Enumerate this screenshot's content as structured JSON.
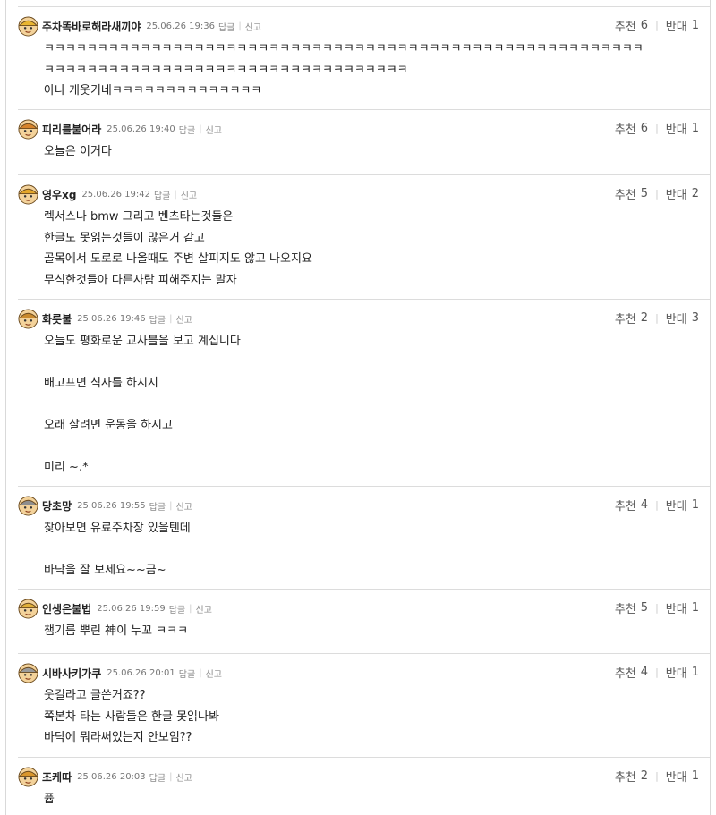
{
  "labels": {
    "reply": "답글",
    "report": "신고",
    "up": "추천",
    "down": "반대"
  },
  "comments": [
    {
      "nick": "주차똑바로해라새끼야",
      "date": "25.06.26 19:36",
      "up": "6",
      "down": "1",
      "lines": [
        "ㅋㅋㅋㅋㅋㅋㅋㅋㅋㅋㅋㅋㅋㅋㅋㅋㅋㅋㅋㅋㅋㅋㅋㅋㅋㅋㅋㅋㅋㅋㅋㅋㅋㅋㅋㅋㅋㅋㅋㅋㅋㅋㅋㅋㅋㅋㅋㅋㅋㅋㅋㅋㅋㅋㅋㅋ",
        "ㅋㅋㅋㅋㅋㅋㅋㅋㅋㅋㅋㅋㅋㅋㅋㅋㅋㅋㅋㅋㅋㅋㅋㅋㅋㅋㅋㅋㅋㅋㅋㅋㅋㅋ",
        "아나 개웃기네ㅋㅋㅋㅋㅋㅋㅋㅋㅋㅋㅋㅋㅋㅋ"
      ],
      "avatar_color": "#e9b530"
    },
    {
      "nick": "피리를불어라",
      "date": "25.06.26 19:40",
      "up": "6",
      "down": "1",
      "lines": [
        "오늘은 이거다"
      ],
      "avatar_color": "#d7842b"
    },
    {
      "nick": "영우xg",
      "date": "25.06.26 19:42",
      "up": "5",
      "down": "2",
      "lines": [
        "렉서스나 bmw 그리고 벤츠타는것들은",
        "한글도 못읽는것들이 많은거 같고",
        "골목에서 도로로 나올때도 주변 살피지도 않고 나오지요",
        "무식한것들아 다른사람 피해주지는 말자"
      ],
      "avatar_color": "#e3a62a"
    },
    {
      "nick": "화릇불",
      "date": "25.06.26 19:46",
      "up": "2",
      "down": "3",
      "lines": [
        "오늘도 평화로운 교사블을 보고 계십니다",
        "",
        "배고프면 식사를 하시지",
        "",
        "오래 살려면 운동을 하시고",
        "",
        "미리 ~.*"
      ],
      "avatar_color": "#c98a2e"
    },
    {
      "nick": "당초망",
      "date": "25.06.26 19:55",
      "up": "4",
      "down": "1",
      "lines": [
        "찾아보면 유료주차장 있을텐데",
        "",
        "바닥을 잘 보세요~~금~"
      ],
      "avatar_color": "#8e8e8e"
    },
    {
      "nick": "인생은불법",
      "date": "25.06.26 19:59",
      "up": "5",
      "down": "1",
      "lines": [
        "챔기름 뿌린 神이 누꼬 ㅋㅋㅋ"
      ],
      "avatar_color": "#e2b13a"
    },
    {
      "nick": "시바사키가쿠",
      "date": "25.06.26 20:01",
      "up": "4",
      "down": "1",
      "lines": [
        "웃길라고 글쓴거죠??",
        "쪽본차 타는 사람들은 한글 못읽나봐",
        "바닥에 뭐라써있는지 안보임??"
      ],
      "avatar_color": "#9a9a9a"
    },
    {
      "nick": "조케따",
      "date": "25.06.26 20:03",
      "up": "2",
      "down": "1",
      "lines": [
        "퓹"
      ],
      "avatar_color": "#d9962d"
    }
  ]
}
